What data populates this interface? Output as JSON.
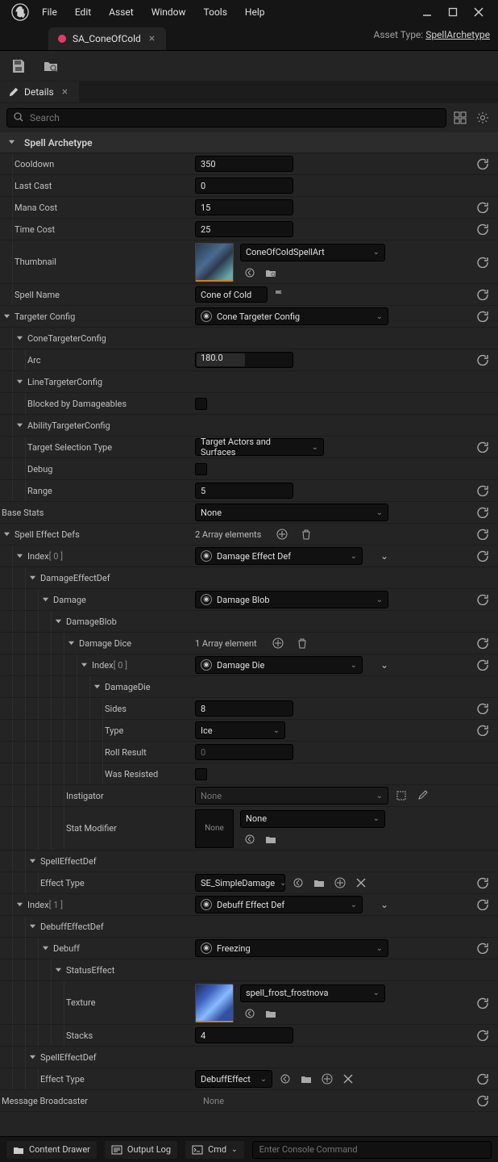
{
  "menu": {
    "file": "File",
    "edit": "Edit",
    "asset": "Asset",
    "window": "Window",
    "tools": "Tools",
    "help": "Help"
  },
  "tab": {
    "name": "SA_ConeOfCold"
  },
  "asset_type": {
    "label": "Asset Type:",
    "value": "SpellArchetype"
  },
  "details": {
    "title": "Details",
    "search_placeholder": "Search"
  },
  "category": {
    "spell_archetype": "Spell Archetype"
  },
  "props": {
    "cooldown": {
      "label": "Cooldown",
      "value": "350"
    },
    "last_cast": {
      "label": "Last Cast",
      "value": "0"
    },
    "mana_cost": {
      "label": "Mana Cost",
      "value": "15"
    },
    "time_cost": {
      "label": "Time Cost",
      "value": "25"
    },
    "thumbnail": {
      "label": "Thumbnail",
      "asset": "ConeOfColdSpellArt"
    },
    "spell_name": {
      "label": "Spell Name",
      "value": "Cone of Cold"
    },
    "targeter_config": {
      "label": "Targeter Config",
      "value": "Cone Targeter Config"
    },
    "cone_targeter": {
      "label": "ConeTargeterConfig"
    },
    "arc": {
      "label": "Arc",
      "value": "180.0"
    },
    "line_targeter": {
      "label": "LineTargeterConfig"
    },
    "blocked_by": {
      "label": "Blocked by Damageables"
    },
    "ability_targeter": {
      "label": "AbilityTargeterConfig"
    },
    "target_sel": {
      "label": "Target Selection Type",
      "value": "Target Actors and Surfaces"
    },
    "debug": {
      "label": "Debug"
    },
    "range": {
      "label": "Range",
      "value": "5"
    },
    "base_stats": {
      "label": "Base Stats",
      "value": "None"
    },
    "spell_effect_defs": {
      "label": "Spell Effect Defs",
      "summary": "2 Array elements"
    },
    "index0": {
      "label": "Index",
      "idx": "[ 0 ]",
      "value": "Damage Effect Def"
    },
    "damage_effect_def": {
      "label": "DamageEffectDef"
    },
    "damage": {
      "label": "Damage",
      "value": "Damage Blob"
    },
    "damage_blob": {
      "label": "DamageBlob"
    },
    "damage_dice": {
      "label": "Damage Dice",
      "summary": "1 Array element"
    },
    "dice_index0": {
      "label": "Index",
      "idx": "[ 0 ]",
      "value": "Damage Die"
    },
    "damage_die": {
      "label": "DamageDie"
    },
    "sides": {
      "label": "Sides",
      "value": "8"
    },
    "type": {
      "label": "Type",
      "value": "Ice"
    },
    "roll_result": {
      "label": "Roll Result",
      "value": "0"
    },
    "was_resisted": {
      "label": "Was Resisted"
    },
    "instigator": {
      "label": "Instigator",
      "value": "None"
    },
    "stat_modifier": {
      "label": "Stat Modifier",
      "value": "None",
      "thumb": "None"
    },
    "spell_effect_def": {
      "label": "SpellEffectDef"
    },
    "effect_type": {
      "label": "Effect Type",
      "value": "SE_SimpleDamage"
    },
    "index1": {
      "label": "Index",
      "idx": "[ 1 ]",
      "value": "Debuff Effect Def"
    },
    "debuff_effect_def": {
      "label": "DebuffEffectDef"
    },
    "debuff": {
      "label": "Debuff",
      "value": "Freezing"
    },
    "status_effect": {
      "label": "StatusEffect"
    },
    "texture": {
      "label": "Texture",
      "asset": "spell_frost_frostnova"
    },
    "stacks": {
      "label": "Stacks",
      "value": "4"
    },
    "effect_type2": {
      "label": "Effect Type",
      "value": "DebuffEffect"
    },
    "message_broadcaster": {
      "label": "Message Broadcaster",
      "value": "None"
    }
  },
  "bottom": {
    "content_drawer": "Content Drawer",
    "output_log": "Output Log",
    "cmd": "Cmd",
    "cmd_placeholder": "Enter Console Command"
  }
}
